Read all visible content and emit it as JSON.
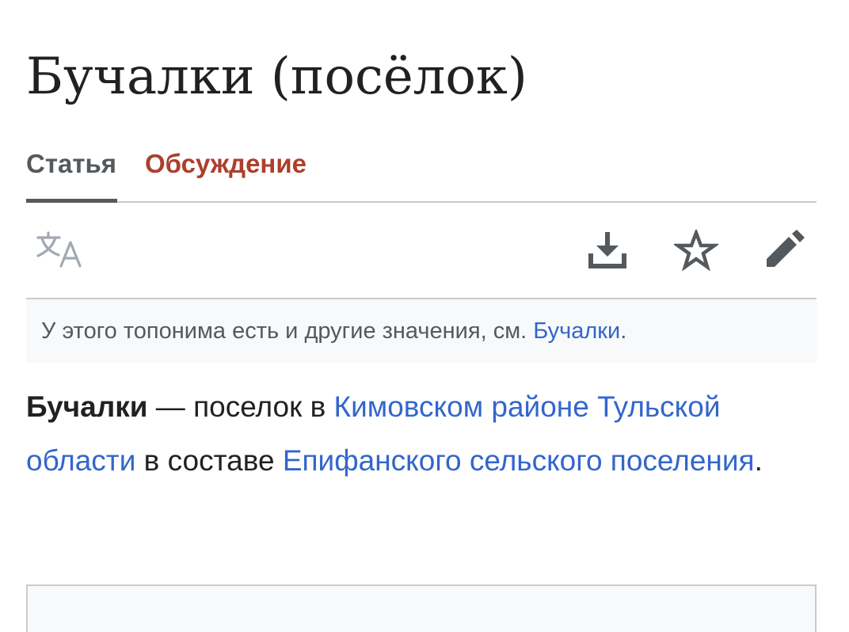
{
  "article": {
    "title": "Бучалки (посёлок)"
  },
  "tabs": [
    {
      "label": "Статья",
      "active": true
    },
    {
      "label": "Обсуждение",
      "active": false
    }
  ],
  "toolbar": {
    "icons": [
      "language-icon",
      "download-icon",
      "star-icon",
      "edit-icon"
    ]
  },
  "hatnote": {
    "text": "У этого топонима есть и другие значения, см. ",
    "link": "Бучалки",
    "end": "."
  },
  "lead": {
    "subject": "Бучалки",
    "dash": " — поселок в ",
    "link1": "Кимовском районе",
    "space1": " ",
    "link2": "Тульской области",
    "mid": " в составе ",
    "link3": "Епифанского сельского поселения",
    "end": "."
  },
  "colors": {
    "link": "#3366cc",
    "talk_tab": "#ac3f2c",
    "text": "#202122",
    "muted": "#54595d",
    "border": "#c8ccd1",
    "hatnote_bg": "#f8f9fa"
  }
}
